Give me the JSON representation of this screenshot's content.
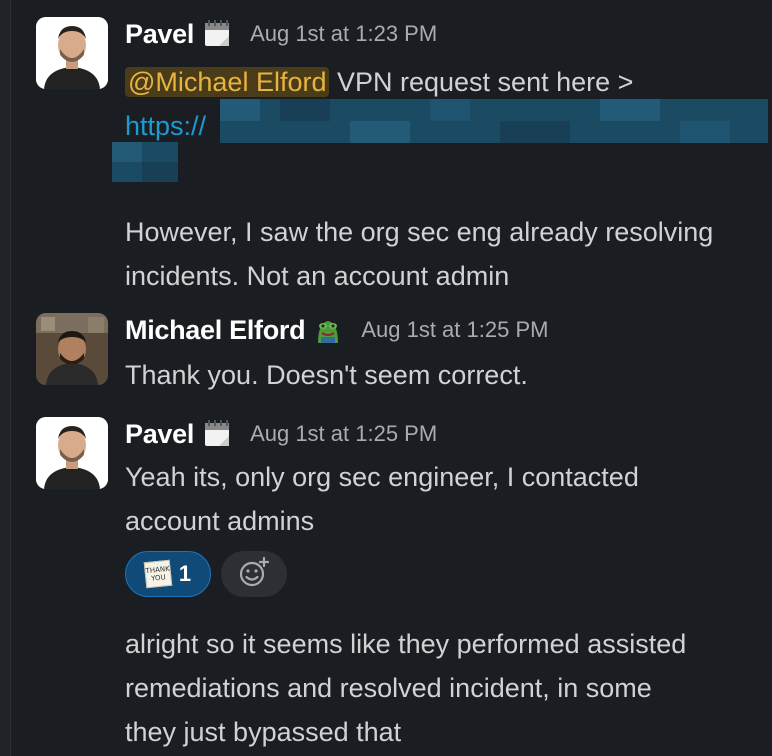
{
  "messages": [
    {
      "author": "Pavel",
      "status_icon": "calendar-icon",
      "timestamp": "Aug 1st at 1:23 PM",
      "mention": "@Michael Elford",
      "line1_rest": " VPN request sent here >",
      "link_prefix": "https://",
      "line3": "However, I saw the org sec eng already resolving",
      "line4": "incidents. Not an account admin"
    },
    {
      "author": "Michael Elford",
      "status_icon": "frog-icon",
      "timestamp": "Aug 1st at 1:25 PM",
      "line1": "Thank you. Doesn't seem correct."
    },
    {
      "author": "Pavel",
      "status_icon": "calendar-icon",
      "timestamp": "Aug 1st at 1:25 PM",
      "line1": "Yeah its, only org sec engineer, I contacted",
      "line2": "account admins",
      "reaction": {
        "emoji": "thank-you-note-icon",
        "emoji_text": "THANK YOU",
        "count": "1"
      },
      "add_reaction": "add-reaction-icon"
    },
    {
      "line1": "alright so it seems like they performed assisted",
      "line2": "remediations and resolved incident, in some",
      "line3": "they just bypassed that"
    }
  ],
  "colors": {
    "background": "#1a1d21",
    "text": "#d1d2d3",
    "link": "#1d9bd1",
    "mention_bg": "#4a3c18",
    "mention_fg": "#e8b43f",
    "reaction_bg": "#0f4a78"
  }
}
